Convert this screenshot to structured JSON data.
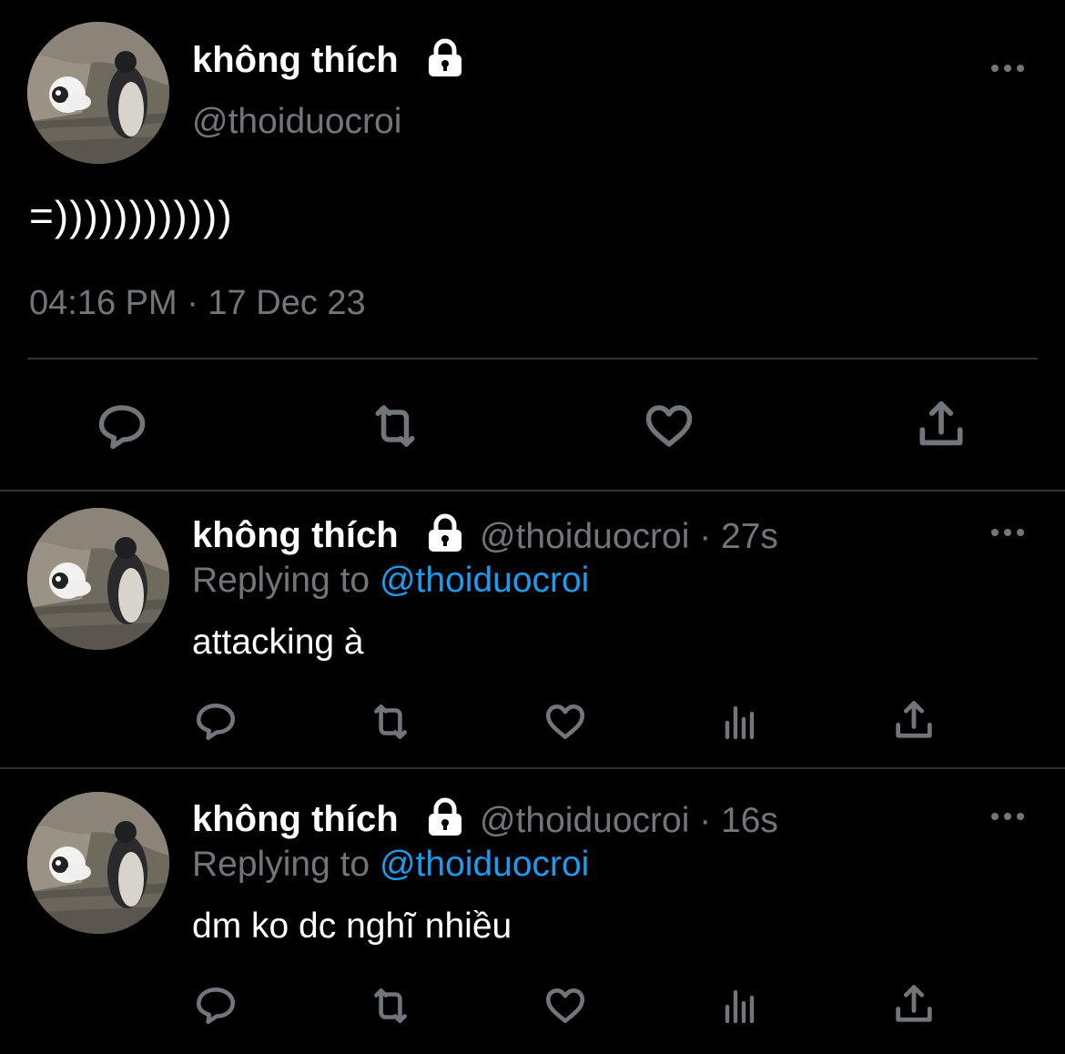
{
  "main_tweet": {
    "display_name": "không thích",
    "handle": "@thoiduocroi",
    "text": "=))))))))))))",
    "timestamp": "04:16 PM · 17 Dec 23",
    "protected_icon": "lock-icon",
    "actions": [
      "reply-icon",
      "retweet-icon",
      "like-icon",
      "share-icon"
    ]
  },
  "replies": [
    {
      "display_name": "không thích",
      "handle_time": "@thoiduocroi · 27s",
      "replying_label": "Replying to",
      "replying_to": "@thoiduocroi",
      "text": "attacking à"
    },
    {
      "display_name": "không thích",
      "handle_time": "@thoiduocroi · 16s",
      "replying_label": "Replying to",
      "replying_to": "@thoiduocroi",
      "text": "dm ko dc nghĩ nhiều"
    }
  ],
  "colors": {
    "background": "#000000",
    "primary_text": "#ffffff",
    "secondary_text": "#71767b",
    "link": "#1d9bf0",
    "divider": "#2f3336"
  }
}
